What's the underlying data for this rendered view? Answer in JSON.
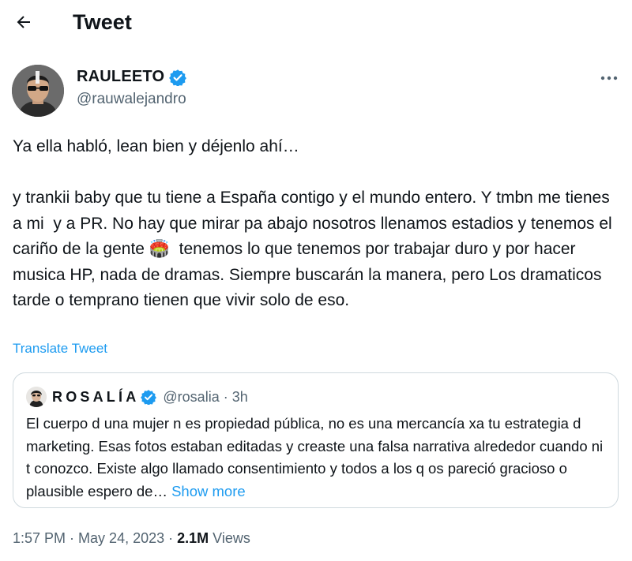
{
  "header": {
    "title": "Tweet",
    "back_icon": "arrow-left-icon"
  },
  "author": {
    "display_name": "RAULEETO",
    "handle": "@rauwalejandro",
    "verified": true,
    "verified_color": "#1d9bf0"
  },
  "tweet": {
    "text": "Ya ella habló, lean bien y déjenlo ahí…\n\ny trankii baby que tu tiene a España contigo y el mundo entero. Y tmbn me tienes a mi  y a PR. No hay que mirar pa abajo nosotros llenamos estadios y tenemos el cariño de la gente 🏟️  tenemos lo que tenemos por trabajar duro y por hacer musica HP, nada de dramas. Siempre buscarán la manera, pero Los dramaticos tarde o temprano tienen que vivir solo de eso.",
    "translate_label": "Translate Tweet",
    "more_icon": "more-horizontal-icon"
  },
  "quoted_tweet": {
    "display_name": "ROSALÍA",
    "handle": "@rosalia",
    "separator": "·",
    "time": "3h",
    "verified": true,
    "text": "El cuerpo d una mujer n es propiedad pública, no es una mercancía xa tu estrategia d marketing. Esas fotos estaban editadas y creaste una falsa narrativa alrededor cuando ni t conozco. Existe algo llamado consentimiento y todos a los q os pareció gracioso o plausible espero de…",
    "show_more_label": "Show more"
  },
  "meta": {
    "time": "1:57 PM",
    "separator": "·",
    "date": "May 24, 2023",
    "views_count": "2.1M",
    "views_label": "Views"
  },
  "colors": {
    "accent": "#1d9bf0",
    "text": "#0f1419",
    "secondary_text": "#536471",
    "border": "#cfd9de"
  }
}
